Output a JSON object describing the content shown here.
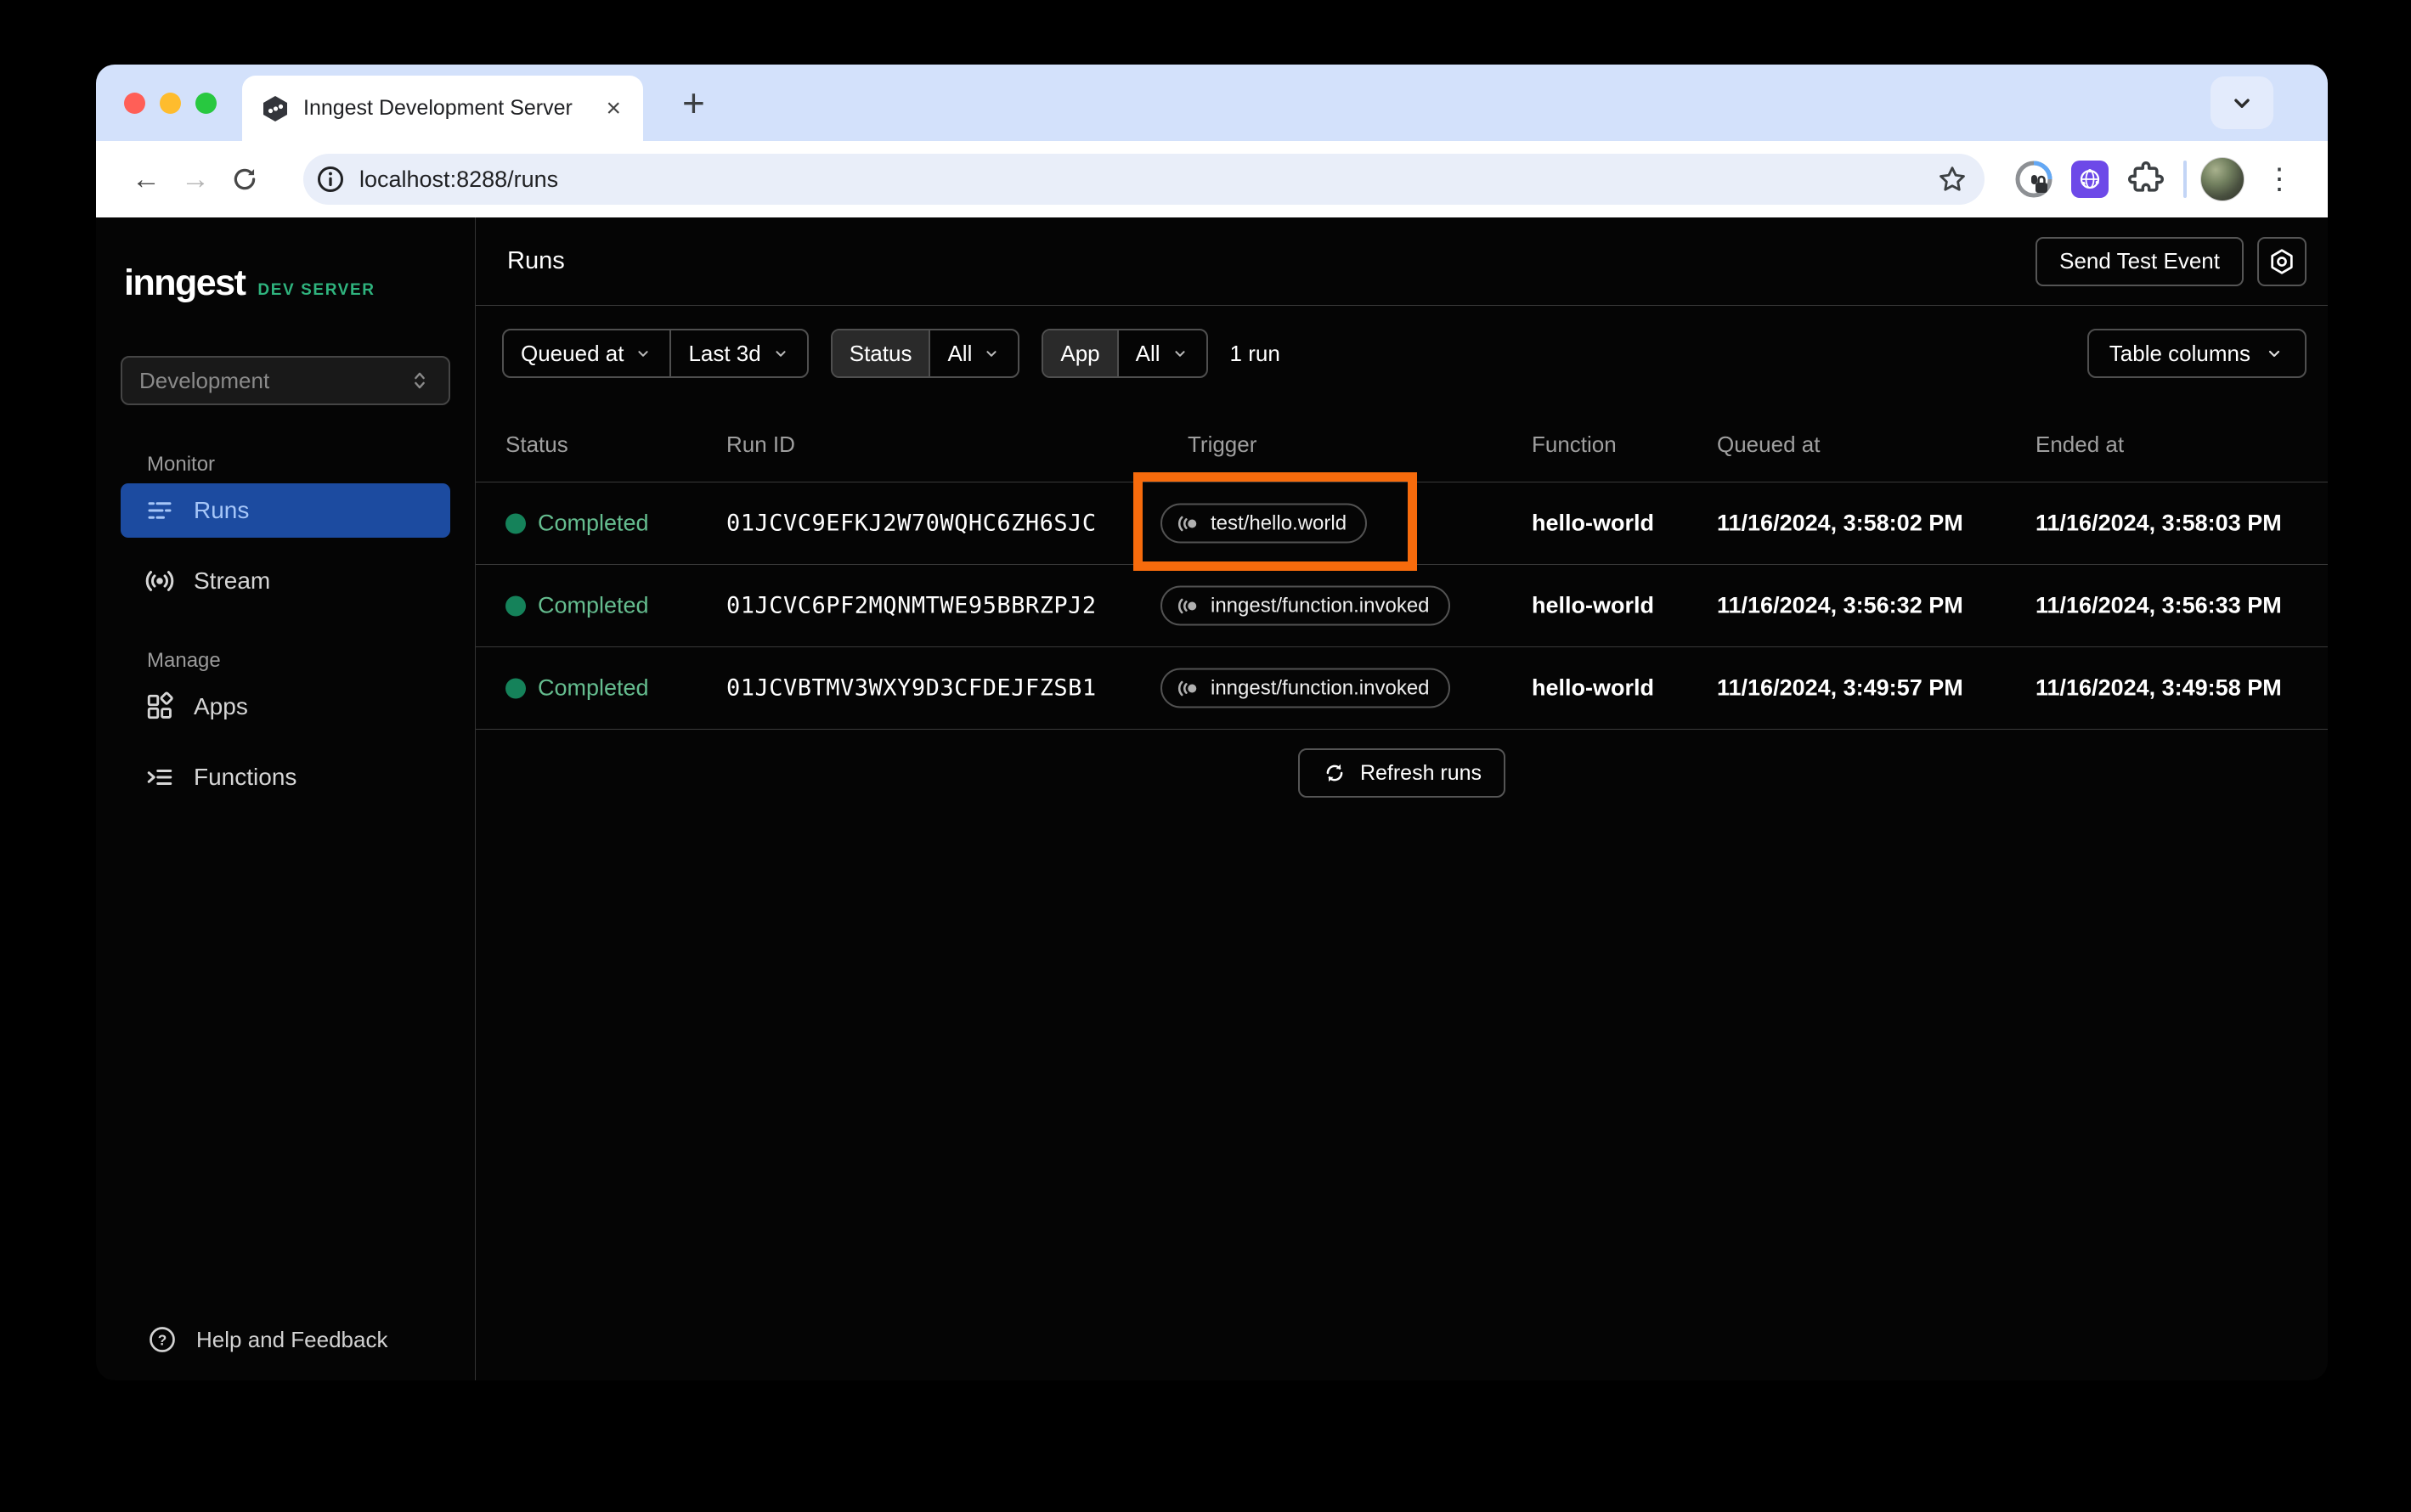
{
  "browser": {
    "tab_title": "Inngest Development Server",
    "url": "localhost:8288/runs"
  },
  "icons": {
    "tab_close": "×",
    "new_tab": "+",
    "back": "←",
    "forward": "→",
    "menu_kebab": "⋮",
    "help": "?"
  },
  "sidebar": {
    "logo": "inngest",
    "logo_badge": "DEV SERVER",
    "env_selector": {
      "value": "Development"
    },
    "sections": [
      {
        "label": "Monitor",
        "items": [
          {
            "label": "Runs",
            "active": true
          },
          {
            "label": "Stream",
            "active": false
          }
        ]
      },
      {
        "label": "Manage",
        "items": [
          {
            "label": "Apps",
            "active": false
          },
          {
            "label": "Functions",
            "active": false
          }
        ]
      }
    ],
    "footer": {
      "help_label": "Help and Feedback"
    }
  },
  "header": {
    "title": "Runs",
    "send_test_event_label": "Send Test Event"
  },
  "filters": {
    "time_field": "Queued at",
    "time_range": "Last 3d",
    "status_label": "Status",
    "status_value": "All",
    "app_label": "App",
    "app_value": "All",
    "result_count": "1 run",
    "table_columns_label": "Table columns"
  },
  "table": {
    "columns": [
      "Status",
      "Run ID",
      "Trigger",
      "Function",
      "Queued at",
      "Ended at"
    ],
    "rows": [
      {
        "status": "Completed",
        "run_id": "01JCVC9EFKJ2W70WQHC6ZH6SJC",
        "trigger": "test/hello.world",
        "function": "hello-world",
        "queued_at": "11/16/2024, 3:58:02 PM",
        "ended_at": "11/16/2024, 3:58:03 PM",
        "highlighted": true
      },
      {
        "status": "Completed",
        "run_id": "01JCVC6PF2MQNMTWE95BBRZPJ2",
        "trigger": "inngest/function.invoked",
        "function": "hello-world",
        "queued_at": "11/16/2024, 3:56:32 PM",
        "ended_at": "11/16/2024, 3:56:33 PM",
        "highlighted": false
      },
      {
        "status": "Completed",
        "run_id": "01JCVBTMV3WXY9D3CFDEJFZSB1",
        "trigger": "inngest/function.invoked",
        "function": "hello-world",
        "queued_at": "11/16/2024, 3:49:57 PM",
        "ended_at": "11/16/2024, 3:49:58 PM",
        "highlighted": false
      }
    ],
    "refresh_label": "Refresh runs"
  },
  "colors": {
    "accent_blue": "#1c4ba0",
    "success_dot": "#15825a",
    "success_text": "#65bd8f",
    "dev_badge_green": "#2fb47e",
    "highlight_orange": "#f76b0c",
    "tab_strip": "#d3e1fb"
  }
}
